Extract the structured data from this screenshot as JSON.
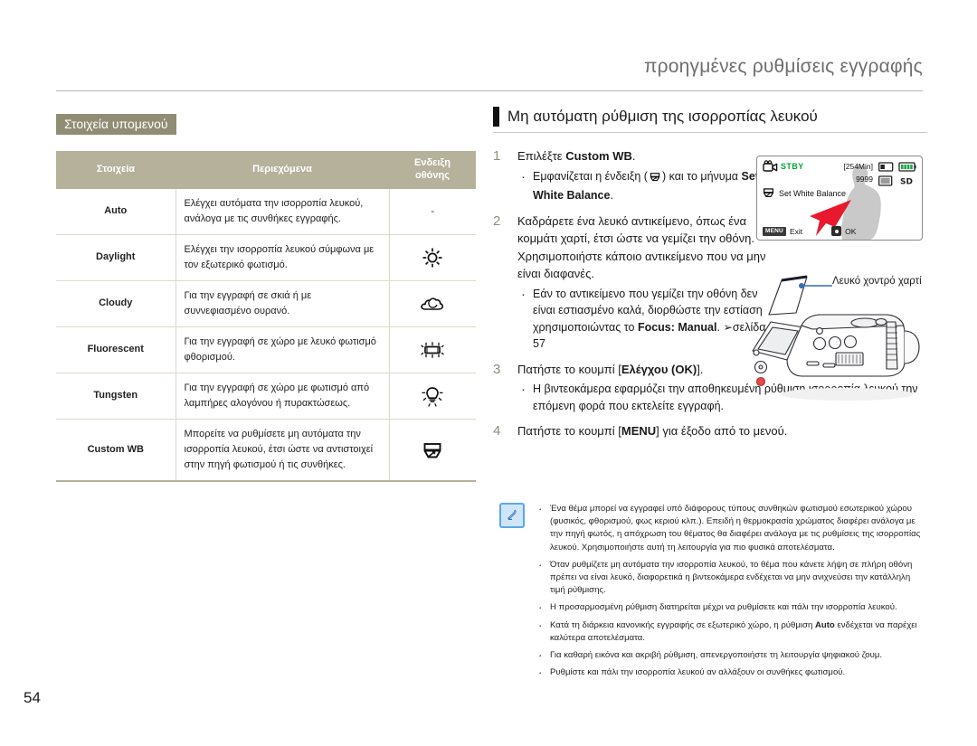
{
  "header": {
    "running_title": "προηγμένες ρυθμίσεις εγγραφής"
  },
  "left": {
    "submenu_tag": "Στοιχεία υπομενού",
    "table": {
      "columns": [
        "Στοιχεία",
        "Περιεχόμενα",
        "Ενδειξη οθόνης"
      ],
      "col_item": "Στοιχεία",
      "col_contents": "Περιεχόμενα",
      "col_indicator_line1": "Ενδειξη",
      "col_indicator_line2": "οθόνης",
      "rows": [
        {
          "item": "Auto",
          "contents": "Ελέγχει αυτόματα την ισορροπία λευκού, ανάλογα με τις συνθήκες εγγραφής.",
          "indicator": "-",
          "icon": "none"
        },
        {
          "item": "Daylight",
          "contents": "Ελέγχει την ισορροπία λευκού σύμφωνα με τον εξωτερικό φωτισμό.",
          "indicator": "",
          "icon": "sun-icon"
        },
        {
          "item": "Cloudy",
          "contents": "Για την εγγραφή σε σκιά ή με συννεφιασμένο ουρανό.",
          "indicator": "",
          "icon": "cloud-icon"
        },
        {
          "item": "Fluorescent",
          "contents": "Για την εγγραφή σε χώρο με λευκό φωτισμό φθορισμού.",
          "indicator": "",
          "icon": "fluorescent-icon"
        },
        {
          "item": "Tungsten",
          "contents": "Για την εγγραφή σε χώρο με φωτισμό από λαμπήρες αλογόνου ή πυρακτώσεως.",
          "indicator": "",
          "icon": "tungsten-icon"
        },
        {
          "item": "Custom WB",
          "contents": "Μπορείτε να ρυθμίσετε μη αυτόματα την ισορροπία λευκού, έτσι ώστε να αντιστοιχεί στην πηγή φωτισμού ή τις συνθήκες.",
          "indicator": "",
          "icon": "custom-wb-icon"
        }
      ]
    }
  },
  "right": {
    "section_title": "Μη αυτόματη ρύθμιση της ισορροπίας λευκού",
    "steps": [
      {
        "num": "1",
        "text_prefix": "Επιλέξτε ",
        "text_bold": "Custom WB",
        "text_suffix": ".",
        "bullets_html": [
          "Εμφανίζεται η ένδειξη ( ICON ) και το μήνυμα Set White Balance."
        ],
        "bullet1_pre": "Εμφανίζεται η ένδειξη (",
        "bullet1_mid": ") και το μήνυμα ",
        "bullet1_bold": "Set White Balance",
        "bullet1_post": "."
      },
      {
        "num": "2",
        "paragraph": "Καδράρετε ένα λευκό αντικείμενο, όπως ένα κομμάτι χαρτί, έτσι ώστε να γεμίζει την οθόνη. Χρησιμοποιήστε κάποιο αντικείμενο που να μην είναι διαφανές.",
        "bullet_pre": "Εάν το αντικείμενο που γεμίζει την οθόνη δεν είναι εστιασμένο καλά, διορθώστε την εστίαση χρησιμοποιώντας το ",
        "bullet_bold": "Focus: Manual",
        "bullet_post": ".",
        "bullet_ref": "σελίδα 57"
      },
      {
        "num": "3",
        "text_pre": "Πατήστε το κουμπί [",
        "text_bold": "Ελέγχου (OK)",
        "text_post": "].",
        "bullet": "Η βιντεοκάμερα εφαρμόζει την αποθηκευμένη ρύθμιση ισορροπία λευκού την επόμενη φορά που εκτελείτε εγγραφή."
      },
      {
        "num": "4",
        "text_pre": "Πατήστε το κουμπί [",
        "text_bold": "MENU",
        "text_post": "] για έξοδο από το μενού."
      }
    ],
    "lcd": {
      "stby": "STBY",
      "minutes": "[254Min]",
      "counter": "9999",
      "message": "Set White Balance",
      "menu_chip": "MENU",
      "exit_label": "Exit",
      "ok_label": "OK"
    },
    "illustration": {
      "paper_label": "Λευκό χοντρό χαρτί"
    },
    "notes": [
      "Ένα θέμα μπορεί να εγγραφεί υπό διάφορους τύπους συνθηκών φωτισμού εσωτερικού χώρου (φυσικός, φθορισμού, φως κεριού κλπ.). Επειδή η θερμοκρασία χρώματος διαφέρει ανάλογα με την πηγή φωτός, η απόχρωση του θέματος θα διαφέρει ανάλογα με τις ρυθμίσεις της ισορροπίας λευκού. Χρησιμοποιήστε αυτή τη λειτουργία για πιο φυσικά αποτελέσματα.",
      "Όταν ρυθμίζετε μη αυτόματα την ισορροπία λευκού, το θέμα που κάνετε λήψη σε πλήρη οθόνη πρέπει να είναι λευκό, διαφορετικά η βιντεοκάμερα ενδέχεται να μην ανιχνεύσει την κατάλληλη τιμή ρύθμισης.",
      "Η προσαρμοσμένη ρύθμιση διατηρείται μέχρι να ρυθμίσετε και πάλι την ισορροπία λευκού.",
      "Κατά τη διάρκεια κανονικής εγγραφής σε εξωτερικό χώρο, η ρύθμιση Auto ενδέχεται να παρέχει καλύτερα αποτελέσματα.",
      "Για καθαρή εικόνα και ακριβή ρύθμιση, απενεργοποιήστε τη λειτουργία ψηφιακού ζουμ.",
      "Ρυθμίστε και πάλι την ισορροπία λευκού αν αλλάξουν οι συνθήκες φωτισμού."
    ],
    "note4_bold": "Auto"
  },
  "folio": {
    "page_number": "54"
  },
  "colors": {
    "accent_olive": "#908d74",
    "table_header": "#b5b19a",
    "stby_green": "#00a13a",
    "note_blue": "#5ba7e8",
    "arrow_red": "#e8192c"
  }
}
